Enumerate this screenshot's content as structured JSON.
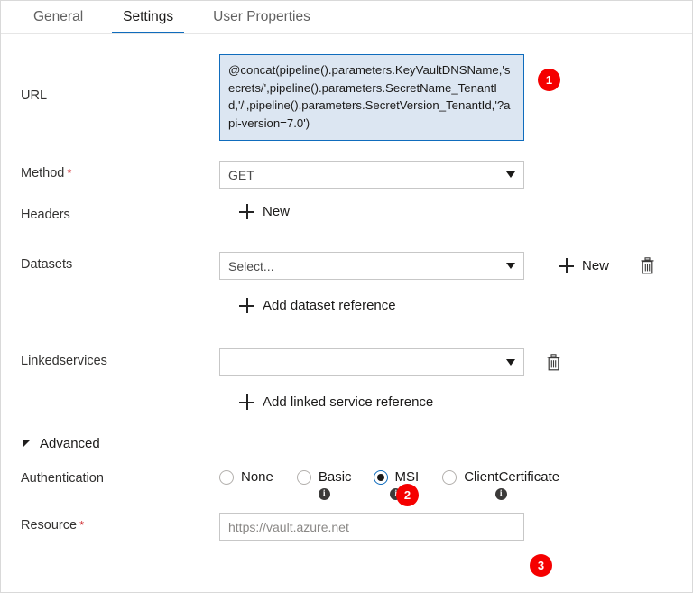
{
  "tabs": [
    {
      "label": "General",
      "active": false
    },
    {
      "label": "Settings",
      "active": true
    },
    {
      "label": "User Properties",
      "active": false
    }
  ],
  "fields": {
    "url": {
      "label": "URL",
      "expression": "@concat(pipeline().parameters.KeyVaultDNSName,'secrets/',pipeline().parameters.SecretName_TenantId,'/',pipeline().parameters.SecretVersion_TenantId,'?api-version=7.0')"
    },
    "method": {
      "label": "Method",
      "required": "*",
      "value": "GET"
    },
    "headers": {
      "label": "Headers",
      "new_label": "New"
    },
    "datasets": {
      "label": "Datasets",
      "value": "Select...",
      "new_label": "New",
      "add_reference_label": "Add dataset reference"
    },
    "linkedservices": {
      "label": "Linkedservices",
      "value": "",
      "add_reference_label": "Add linked service reference"
    },
    "resource": {
      "label": "Resource",
      "required": "*",
      "value": "",
      "placeholder": "https://vault.azure.net"
    }
  },
  "advanced": {
    "label": "Advanced",
    "authentication": {
      "label": "Authentication",
      "options": [
        {
          "label": "None",
          "checked": false,
          "has_info": false
        },
        {
          "label": "Basic",
          "checked": false,
          "has_info": true
        },
        {
          "label": "MSI",
          "checked": true,
          "has_info": true
        },
        {
          "label": "ClientCertificate",
          "checked": false,
          "has_info": true
        }
      ],
      "info_glyph": "i"
    }
  },
  "annotations": [
    {
      "number": "1"
    },
    {
      "number": "2"
    },
    {
      "number": "3"
    }
  ],
  "colors": {
    "accent": "#0f6cbd",
    "badge": "#f50000",
    "required": "#d13438",
    "expression_fill": "#dce6f2"
  }
}
